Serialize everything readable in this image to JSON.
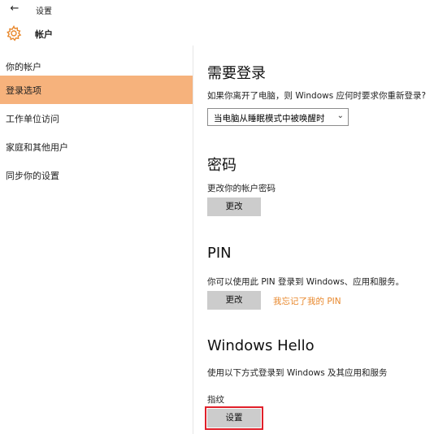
{
  "window": {
    "title": "设置"
  },
  "header": {
    "title": "帐户"
  },
  "sidebar": {
    "items": [
      {
        "label": "你的帐户"
      },
      {
        "label": "登录选项"
      },
      {
        "label": "工作单位访问"
      },
      {
        "label": "家庭和其他用户"
      },
      {
        "label": "同步你的设置"
      }
    ],
    "selected_index": 1
  },
  "sections": {
    "require_signin": {
      "heading": "需要登录",
      "description": "如果你离开了电脑，则 Windows 应何时要求你重新登录?",
      "dropdown_value": "当电脑从睡眠模式中被唤醒时"
    },
    "password": {
      "heading": "密码",
      "description": "更改你的帐户密码",
      "button_label": "更改"
    },
    "pin": {
      "heading": "PIN",
      "description": "你可以使用此 PIN 登录到 Windows、应用和服务。",
      "button_label": "更改",
      "link_label": "我忘记了我的 PIN"
    },
    "windows_hello": {
      "heading": "Windows Hello",
      "description": "使用以下方式登录到 Windows 及其应用和服务",
      "fingerprint_label": "指纹",
      "button_label": "设置"
    }
  },
  "colors": {
    "accent": "#f6b27c",
    "link": "#e8872b",
    "highlight_border": "#e0202a",
    "button_bg": "#cccccc"
  },
  "icons": {
    "back": "back-arrow-icon",
    "gear": "gear-icon",
    "dropdown": "chevron-down-icon"
  }
}
